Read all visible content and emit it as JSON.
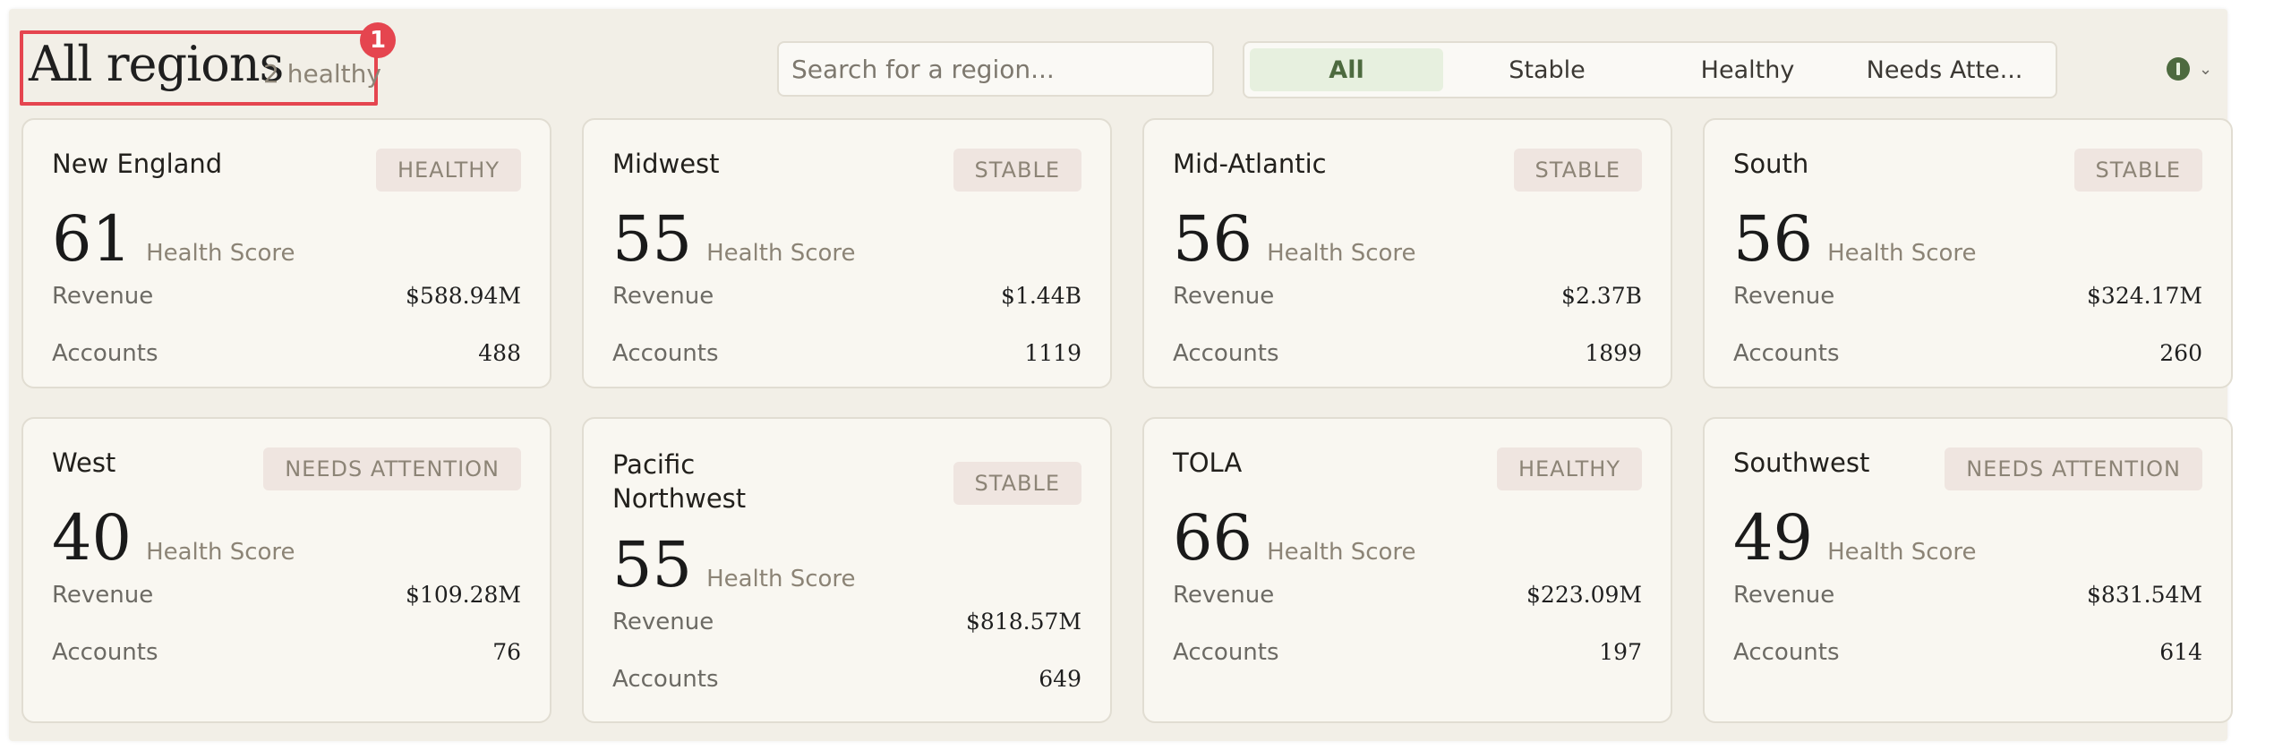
{
  "header": {
    "title": "All regions",
    "subtitle": "2 healthy",
    "badge_count": "1"
  },
  "search": {
    "placeholder": "Search for a region..."
  },
  "filters": [
    {
      "label": "All",
      "active": true
    },
    {
      "label": "Stable",
      "active": false
    },
    {
      "label": "Healthy",
      "active": false
    },
    {
      "label": "Needs Atte...",
      "active": false
    }
  ],
  "status_indicator": {
    "icon": "status-dot-icon",
    "color": "#4d6a3f"
  },
  "labels": {
    "score": "Health Score",
    "revenue": "Revenue",
    "accounts": "Accounts"
  },
  "regions": [
    {
      "name": "New England",
      "status": "HEALTHY",
      "score": "61",
      "revenue": "$588.94M",
      "accounts": "488"
    },
    {
      "name": "Midwest",
      "status": "STABLE",
      "score": "55",
      "revenue": "$1.44B",
      "accounts": "1119"
    },
    {
      "name": "Mid-Atlantic",
      "status": "STABLE",
      "score": "56",
      "revenue": "$2.37B",
      "accounts": "1899"
    },
    {
      "name": "South",
      "status": "STABLE",
      "score": "56",
      "revenue": "$324.17M",
      "accounts": "260"
    },
    {
      "name": "West",
      "status": "NEEDS ATTENTION",
      "score": "40",
      "revenue": "$109.28M",
      "accounts": "76"
    },
    {
      "name": "Pacific Northwest",
      "status": "STABLE",
      "score": "55",
      "revenue": "$818.57M",
      "accounts": "649"
    },
    {
      "name": "TOLA",
      "status": "HEALTHY",
      "score": "66",
      "revenue": "$223.09M",
      "accounts": "197"
    },
    {
      "name": "Southwest",
      "status": "NEEDS ATTENTION",
      "score": "49",
      "revenue": "$831.54M",
      "accounts": "614"
    }
  ],
  "colors": {
    "accent": "#4d6a3f",
    "highlight": "#e5454f",
    "tag_bg": "#efe5e0",
    "card_bg": "#f9f7f1"
  }
}
